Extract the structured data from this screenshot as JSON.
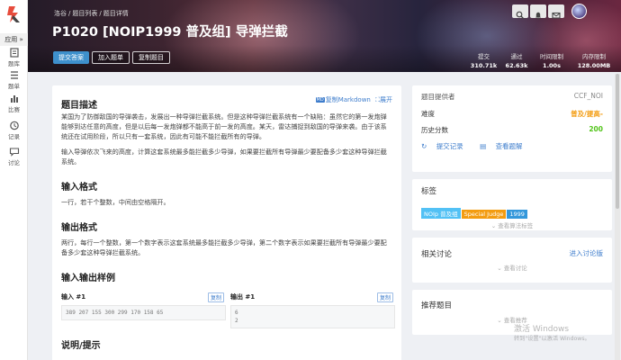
{
  "sidebar": {
    "apps_label": "应用 »",
    "items": [
      {
        "label": "题库",
        "icon": "book-icon"
      },
      {
        "label": "题单",
        "icon": "list-icon"
      },
      {
        "label": "比赛",
        "icon": "bar-chart-icon"
      },
      {
        "label": "记录",
        "icon": "clock-icon"
      },
      {
        "label": "讨论",
        "icon": "chat-icon"
      }
    ]
  },
  "header": {
    "breadcrumb": [
      "洛谷",
      "/",
      "题目列表",
      "/",
      "题目详情"
    ],
    "title": "P1020 [NOIP1999 普及组] 导弹拦截",
    "buttons": {
      "submit": "提交答案",
      "add_to_list": "加入题单",
      "copy_problem": "复制题目"
    },
    "stats": [
      {
        "key": "提交",
        "value": "310.71k"
      },
      {
        "key": "通过",
        "value": "62.63k"
      },
      {
        "key": "时间限制",
        "value": "1.00s"
      },
      {
        "key": "内存限制",
        "value": "128.00MB"
      }
    ]
  },
  "content": {
    "desc_title": "题目描述",
    "copy_markdown": "复制Markdown",
    "expand": "展开",
    "md_badge": "MD",
    "desc_p1": "某国为了防御敌国的导弹袭击，发展出一种导弹拦截系统。但是这种导弹拦截系统有一个缺陷：虽然它的第一发炮弹能够到达任意的高度，但是以后每一发炮弹都不能高于前一发的高度。某天，雷达捕捉到敌国的导弹来袭。由于该系统还在试用阶段，所以只有一套系统，因此有可能不能拦截所有的导弹。",
    "desc_p2": "输入导弹依次飞来的高度，计算这套系统最多能拦截多少导弹，如果要拦截所有导弹最少要配备多少套这种导弹拦截系统。",
    "input_title": "输入格式",
    "input_text": "一行，若干个整数，中间由空格隔开。",
    "output_title": "输出格式",
    "output_text": "两行，每行一个整数，第一个数字表示这套系统最多能拦截多少导弹，第二个数字表示如果要拦截所有导弹最少要配备多少套这种导弹拦截系统。",
    "sample_title": "输入输出样例",
    "input_label": "输入 #1",
    "output_label": "输出 #1",
    "copy_label": "复制",
    "sample_input": "389 207 155 300 299 170 158 65",
    "sample_output_1": "6",
    "sample_output_2": "2",
    "hint_title": "说明/提示"
  },
  "info": {
    "provider_label": "题目提供者",
    "provider_value": "CCF_NOI",
    "difficulty_label": "难度",
    "difficulty_value": "普及/提高-",
    "score_label": "历史分数",
    "score_value": "200",
    "submissions_link": "提交记录",
    "solutions_link": "查看题解"
  },
  "tags": {
    "title": "标签",
    "items": [
      {
        "label": "NOIp 普及组",
        "color": "#52c1f5"
      },
      {
        "label": "Special Judge",
        "color": "#f39c11"
      },
      {
        "label": "1999",
        "color": "#3498db"
      }
    ],
    "view_algo": "查看算法标签"
  },
  "discussion": {
    "title": "相关讨论",
    "enter": "进入讨论版",
    "view": "查看讨论"
  },
  "recommend": {
    "title": "推荐题目",
    "view": "查看推荐"
  },
  "watermark": {
    "line1": "激活 Windows",
    "line2": "转到\"设置\"以激活 Windows。"
  },
  "colors": {
    "accent": "#3e90cc",
    "difficulty": "#f39c11",
    "score": "#52c41a"
  }
}
